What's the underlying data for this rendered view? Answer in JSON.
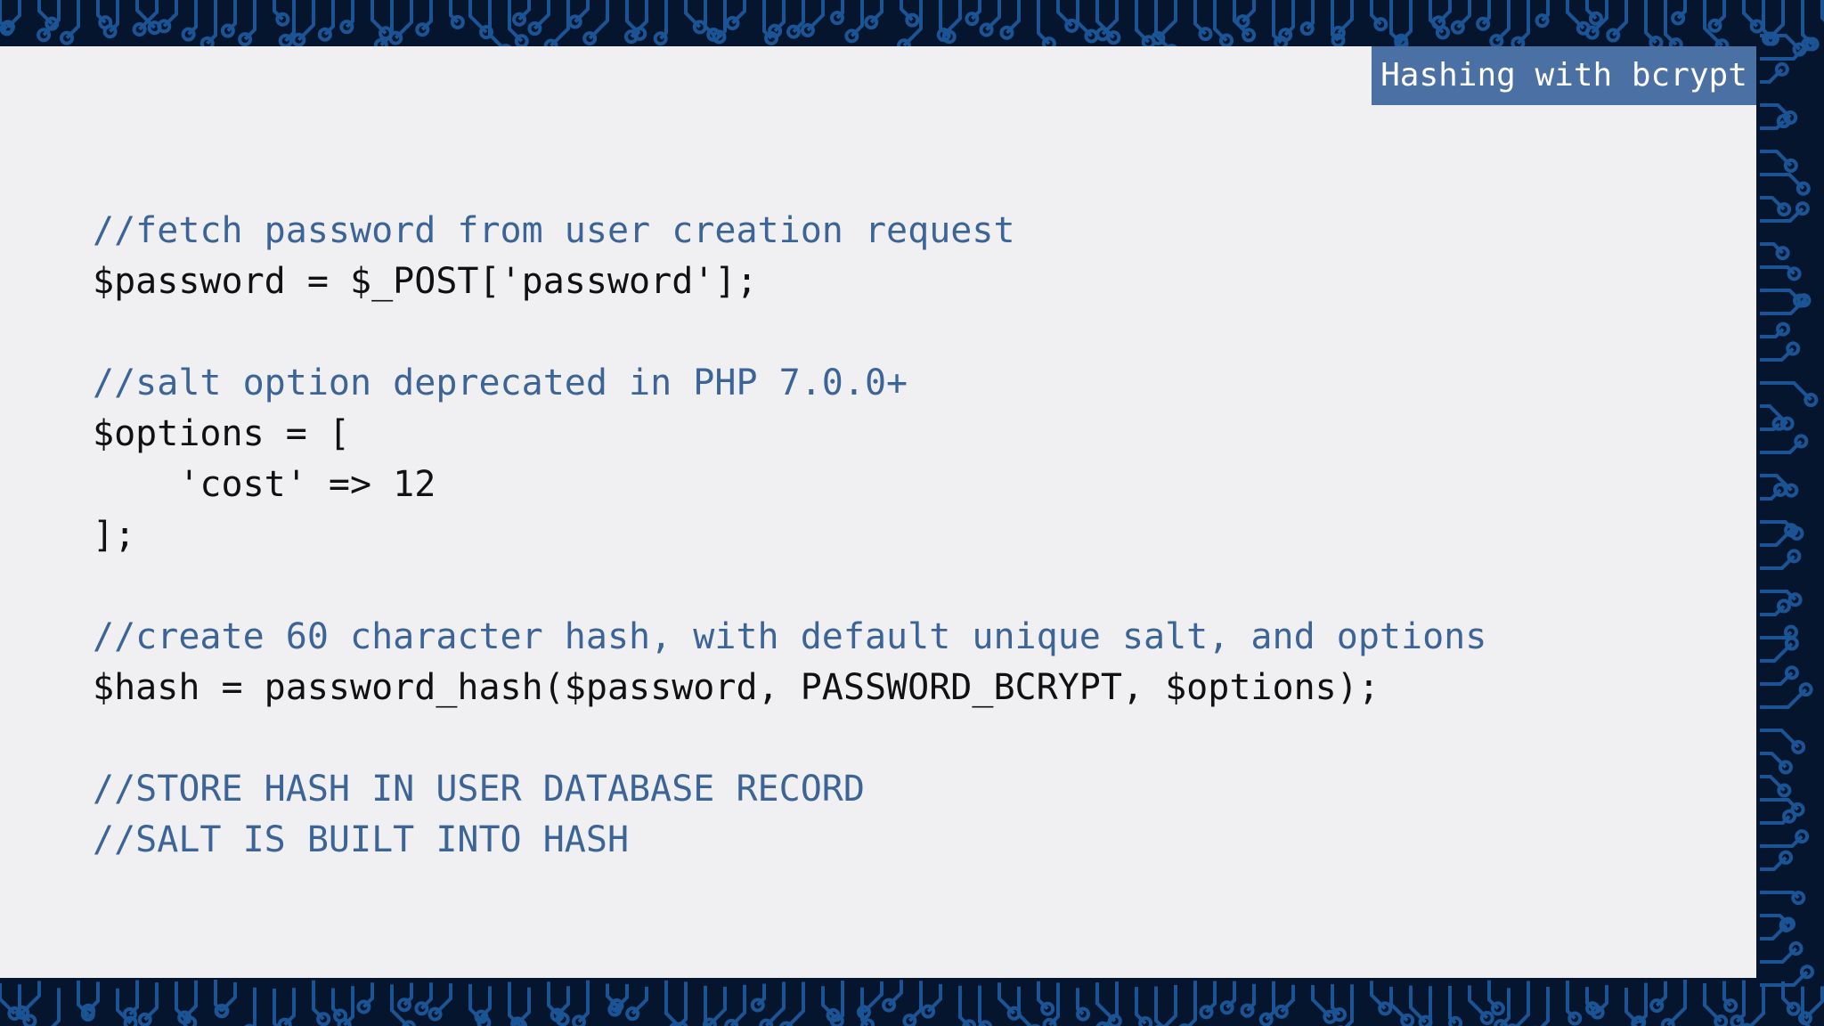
{
  "slide": {
    "title": "Hashing with bcrypt",
    "code_lines": [
      {
        "kind": "comment",
        "text": "//fetch password from user creation request"
      },
      {
        "kind": "code",
        "text": "$password = $_POST['password'];"
      },
      {
        "kind": "blank",
        "text": ""
      },
      {
        "kind": "comment",
        "text": "//salt option deprecated in PHP 7.0.0+"
      },
      {
        "kind": "code",
        "text": "$options = ["
      },
      {
        "kind": "code",
        "text": "    'cost' => 12"
      },
      {
        "kind": "code",
        "text": "];"
      },
      {
        "kind": "blank",
        "text": ""
      },
      {
        "kind": "comment",
        "text": "//create 60 character hash, with default unique salt, and options"
      },
      {
        "kind": "code",
        "text": "$hash = password_hash($password, PASSWORD_BCRYPT, $options);"
      },
      {
        "kind": "blank",
        "text": ""
      },
      {
        "kind": "comment",
        "text": "//STORE HASH IN USER DATABASE RECORD"
      },
      {
        "kind": "comment",
        "text": "//SALT IS BUILT INTO HASH"
      }
    ]
  },
  "colors": {
    "background": "#06152e",
    "circuit": "#1f5fa6",
    "slide": "#f0f0f2",
    "title_tab": "#4a70a4",
    "comment": "#3c6496",
    "code": "#111111"
  }
}
